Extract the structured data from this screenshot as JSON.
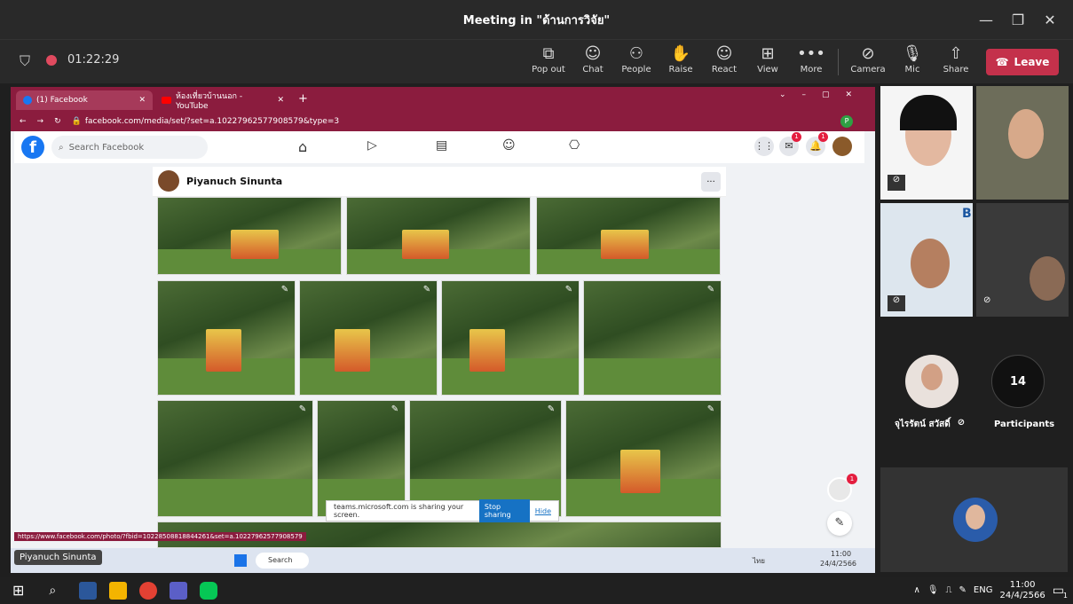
{
  "window": {
    "title": "Meeting in \"ด้านการวิจัย\""
  },
  "meeting": {
    "timer": "01:22:29"
  },
  "toolbar": {
    "pop_out": "Pop out",
    "chat": "Chat",
    "people": "People",
    "raise": "Raise",
    "react": "React",
    "view": "View",
    "more": "More",
    "camera": "Camera",
    "mic": "Mic",
    "share": "Share",
    "leave": "Leave"
  },
  "browser": {
    "tab1": "(1) Facebook",
    "tab2": "ห้องเที่ยวบ้านนอก - YouTube",
    "url": "facebook.com/media/set/?set=a.10227962577908579&type=3",
    "profile_initial": "P"
  },
  "facebook": {
    "search_placeholder": "Search Facebook",
    "author": "Piyanuch Sinunta",
    "more": "...",
    "messenger_badge": "1",
    "notif_badge": "1",
    "chat_badge": "1"
  },
  "status_url": "https://www.facebook.com/photo/?fbid=10228508818844261&set=a.10227962577908579",
  "sharing": {
    "text": "teams.microsoft.com is sharing your screen.",
    "stop": "Stop sharing",
    "hide": "Hide"
  },
  "presenter_label": "Piyanuch Sinunta",
  "inner_taskbar": {
    "search": "Search",
    "lang": "ไทย",
    "time": "11:00",
    "date": "24/4/2566"
  },
  "participants": {
    "person_name": "จุไรรัตน์ สวัสดิ์",
    "count": "14",
    "count_label": "Participants",
    "tile_letter": "B"
  },
  "taskbar": {
    "lang": "ENG",
    "time": "11:00",
    "date": "24/4/2566",
    "notify": "1"
  }
}
